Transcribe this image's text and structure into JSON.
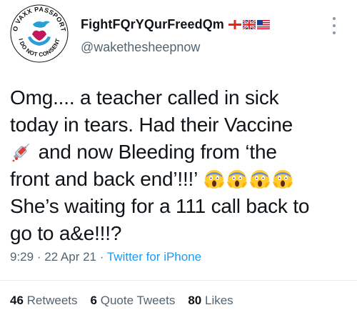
{
  "author": {
    "display_name": "FightFQrYQurFreedQm",
    "handle": "@wakethesheepnow",
    "avatar": {
      "top_text": "NO VAXX PASSPORTS",
      "bottom_text": "I DO NOT CONSENT"
    }
  },
  "tweet": {
    "lines": [
      "Omg.... a teacher called in sick",
      "today in tears. Had their Vaccine",
      " and now Bleeding from ‘the",
      "front and back end’!!!’",
      "She’s waiting for a 111 call back to",
      "go to a&e!!!?"
    ]
  },
  "meta": {
    "time": "9:29",
    "date": "22 Apr 21",
    "source": "Twitter for iPhone",
    "separator": "·"
  },
  "stats": {
    "retweets_count": "46",
    "retweets_label": "Retweets",
    "quotes_count": "6",
    "quotes_label": "Quote Tweets",
    "likes_count": "80",
    "likes_label": "Likes"
  },
  "colors": {
    "link": "#1d9bf0",
    "secondary_text": "#536471",
    "primary_text": "#0f1419"
  },
  "icons": {
    "flags": [
      "england-flag-icon",
      "uk-flag-icon",
      "us-flag-icon"
    ],
    "inline": [
      "syringe-icon",
      "screaming-face-icon"
    ]
  }
}
